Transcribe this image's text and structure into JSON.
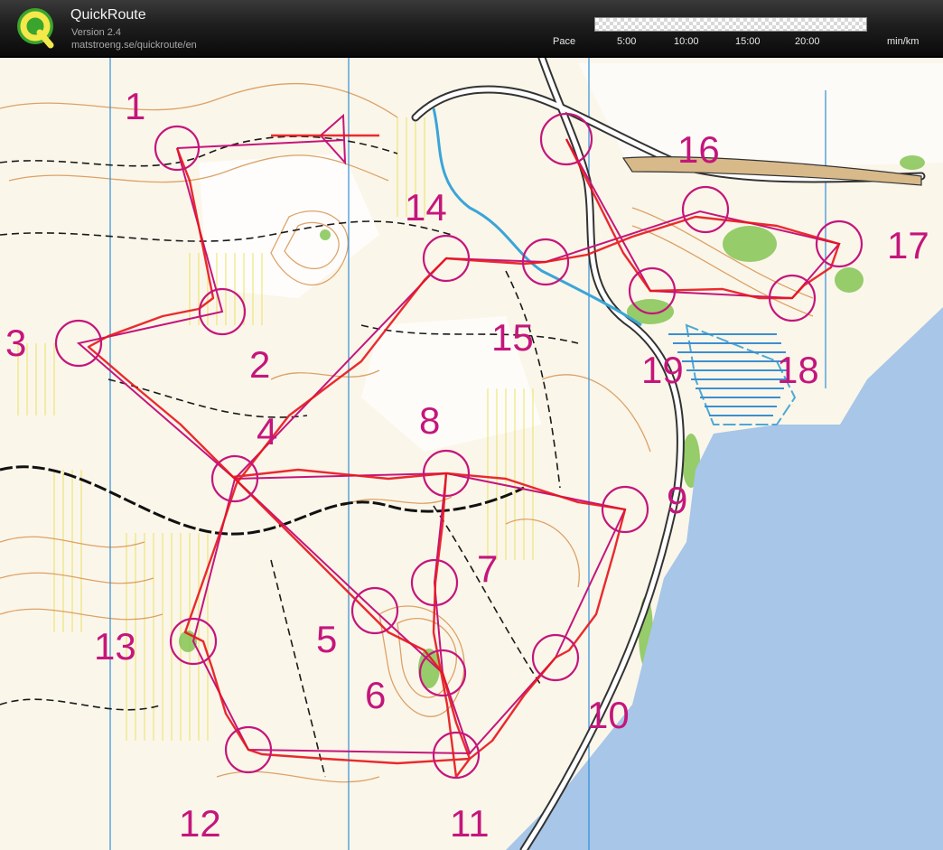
{
  "header": {
    "app_title": "QuickRoute",
    "version": "Version 2.4",
    "url": "matstroeng.se/quickroute/en",
    "pace": {
      "label": "Pace",
      "ticks": [
        "5:00",
        "10:00",
        "15:00",
        "20:00"
      ],
      "unit": "min/km"
    }
  },
  "map": {
    "course_color": "#c4167c",
    "route_color": "#e8151b",
    "water_color": "#a7c6e8",
    "controls": [
      "1",
      "2",
      "3",
      "4",
      "5",
      "6",
      "7",
      "8",
      "9",
      "10",
      "11",
      "12",
      "13",
      "14",
      "15",
      "16",
      "17",
      "18",
      "19"
    ]
  }
}
